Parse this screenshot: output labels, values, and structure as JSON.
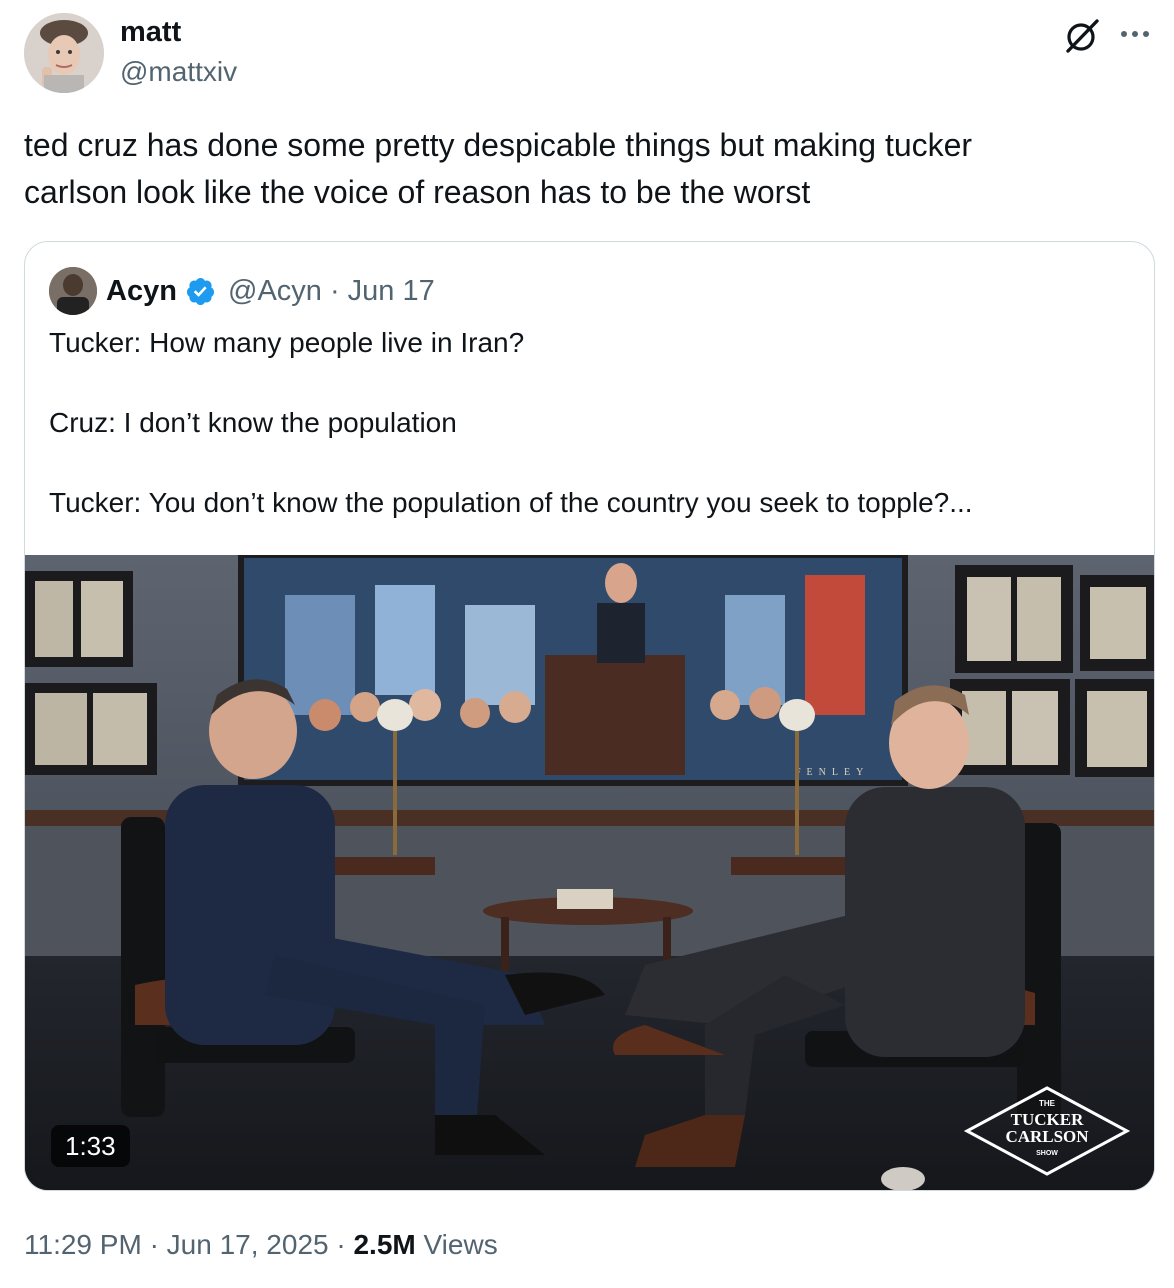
{
  "author": {
    "name": "matt",
    "handle": "@mattxiv"
  },
  "tweet_text": "ted cruz has done some pretty despicable things but making tucker\ncarlson look like the voice of reason has to be the worst",
  "icons": {
    "grok": "grok-icon",
    "more": "more-icon",
    "verified": "verified-badge-icon"
  },
  "quoted_tweet": {
    "name": "Acyn",
    "meta": "@Acyn · Jun 17",
    "text": "Tucker: How many people live in Iran?\n\nCruz: I don’t know the population\n\nTucker: You don’t know the population of the country you seek to topple?...",
    "video": {
      "duration": "1:33",
      "logo_lines": [
        "THE",
        "TUCKER",
        "CARLSON",
        "SHOW"
      ],
      "painting_signature": "FENLEY"
    }
  },
  "footer": {
    "time": "11:29 PM",
    "date": "Jun 17, 2025",
    "separator": "·",
    "views_count": "2.5M",
    "views_label": "Views"
  },
  "colors": {
    "text_primary": "#0f1419",
    "text_secondary": "#536471",
    "border": "#cfd9de",
    "verified_blue": "#1d9bf0"
  }
}
